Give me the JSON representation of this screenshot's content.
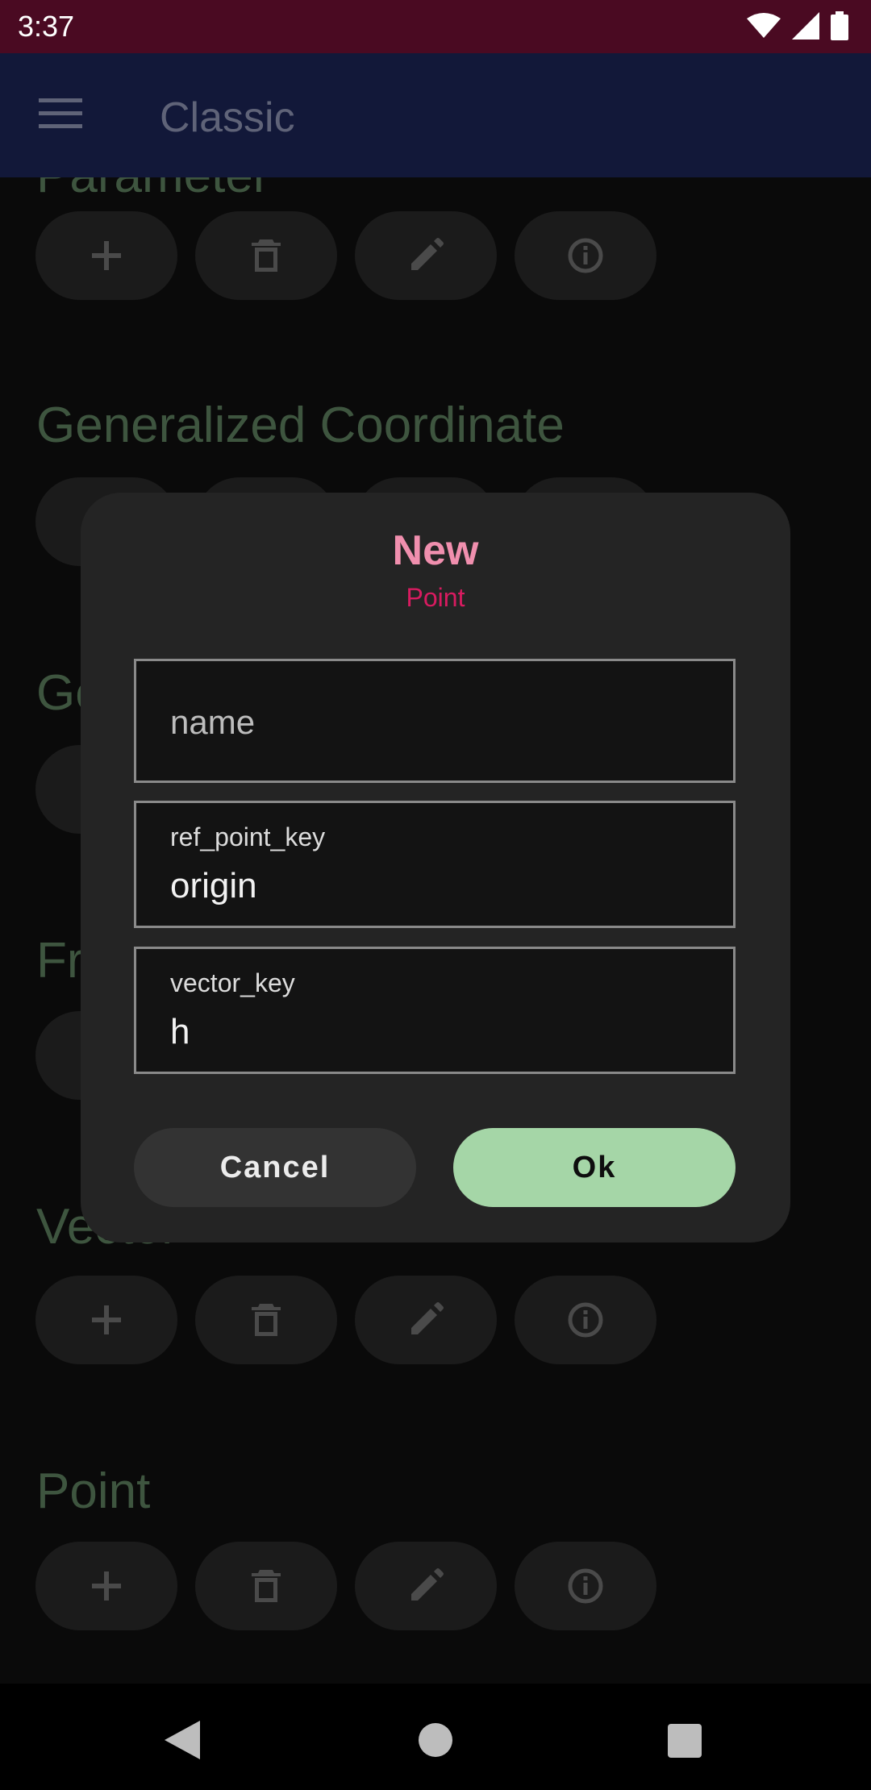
{
  "status_bar": {
    "time": "3:37"
  },
  "app_bar": {
    "title": "Classic",
    "menu_icon": "hamburger-menu-icon"
  },
  "sections": [
    {
      "title": "Parameter"
    },
    {
      "title": "Generalized Coordinate"
    },
    {
      "title": "Ge"
    },
    {
      "title": "Fr"
    },
    {
      "title": "Vector"
    },
    {
      "title": "Point"
    }
  ],
  "action_icons": [
    "plus-icon",
    "trash-icon",
    "pencil-icon",
    "info-icon"
  ],
  "dialog": {
    "title": "New",
    "subtitle": "Point",
    "fields": [
      {
        "placeholder": "name",
        "label": "",
        "value": ""
      },
      {
        "label": "ref_point_key",
        "value": "origin"
      },
      {
        "label": "vector_key",
        "value": "h"
      }
    ],
    "cancel_label": "Cancel",
    "ok_label": "Ok"
  },
  "colors": {
    "status_bar": "#4a0a22",
    "app_bar": "#121839",
    "dialog_bg": "#242424",
    "title_pink": "#f08fae",
    "subtitle_pink": "#d81b60",
    "ok_green": "#a5d6a7",
    "section_title_green": "#3e553f"
  }
}
